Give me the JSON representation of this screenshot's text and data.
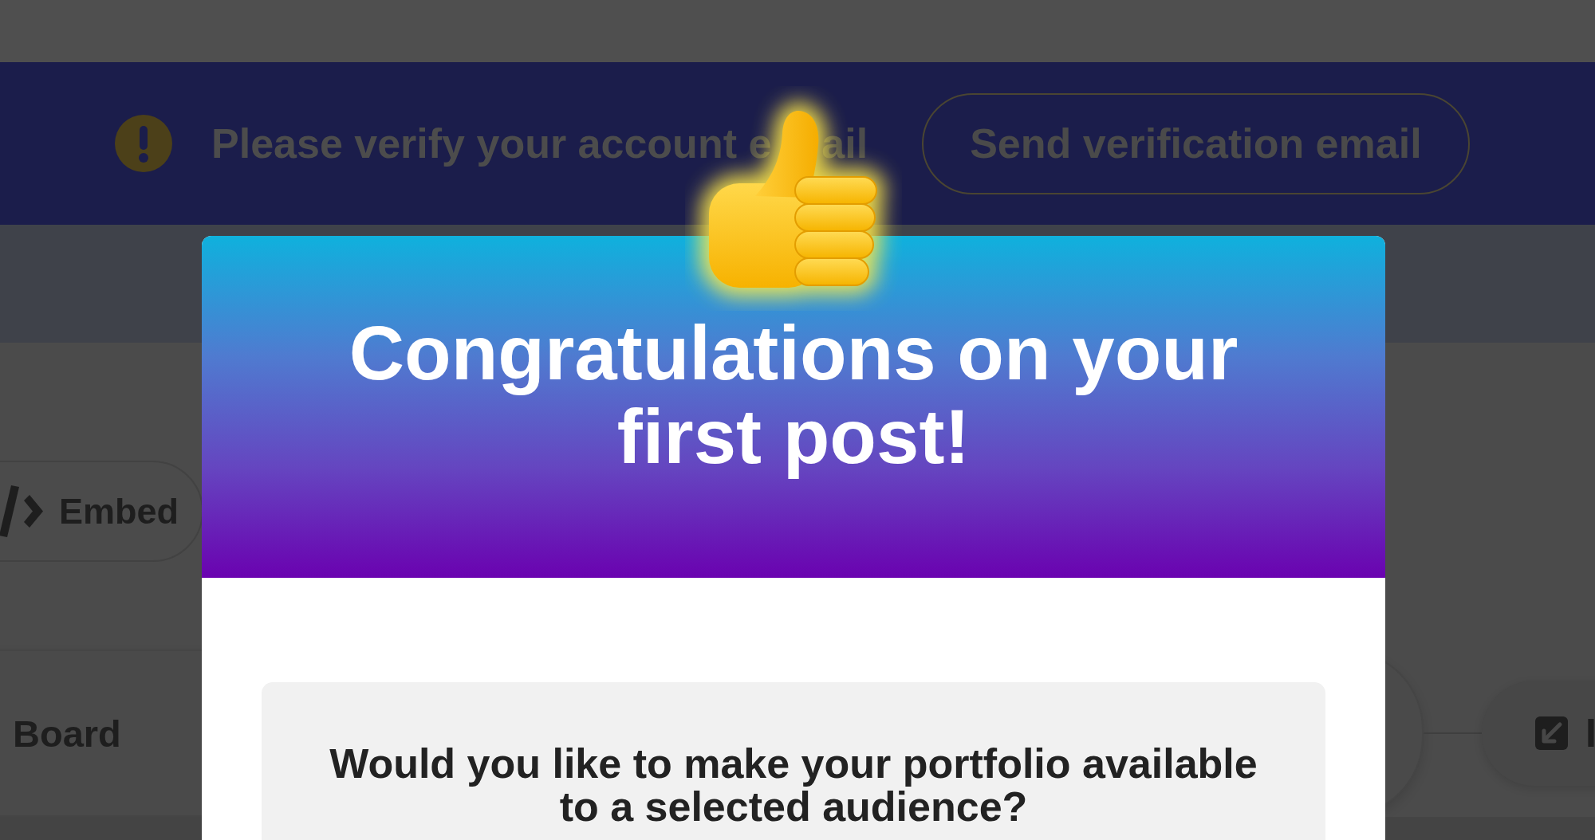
{
  "banner": {
    "message_parts": [
      "Please verify your account e",
      "ail"
    ],
    "button": "Send verification email"
  },
  "page": {
    "embed_button": "Embed",
    "board": {
      "label": "Board"
    },
    "action_button": "I"
  },
  "dialog": {
    "title": "Congratulations on your first post!",
    "question": "Would you like to make your portfolio available to a selected audience?"
  }
}
